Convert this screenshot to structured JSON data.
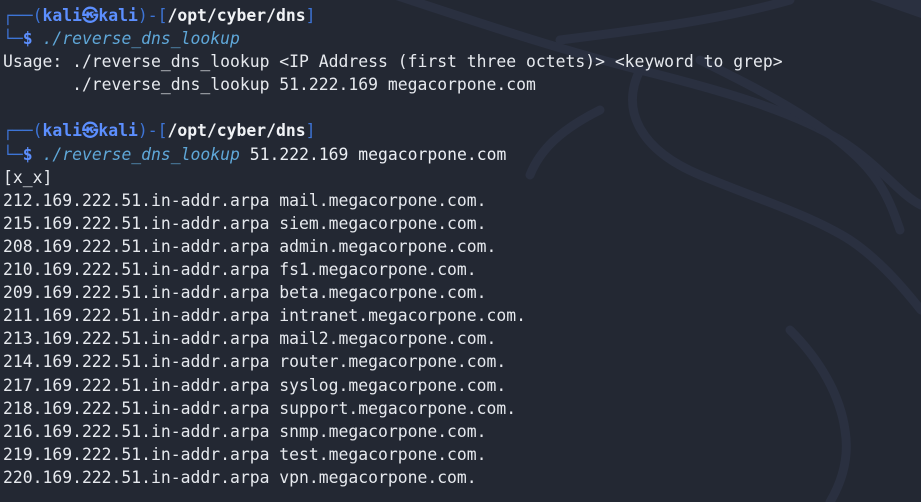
{
  "prompt1": {
    "top_left": "┌──(",
    "user": "kali",
    "skull": "㉿",
    "host": "kali",
    "mid": ")-[",
    "path": "/opt/cyber/dns",
    "end": "]",
    "bottom_left": "└─",
    "dollar": "$ ",
    "command": "./reverse_dns_lookup",
    "args": ""
  },
  "usage": [
    "Usage: ./reverse_dns_lookup <IP Address (first three octets)> <keyword to grep>",
    "       ./reverse_dns_lookup 51.222.169 megacorpone.com"
  ],
  "prompt2": {
    "top_left": "┌──(",
    "user": "kali",
    "skull": "㉿",
    "host": "kali",
    "mid": ")-[",
    "path": "/opt/cyber/dns",
    "end": "]",
    "bottom_left": "└─",
    "dollar": "$ ",
    "command": "./reverse_dns_lookup",
    "args": " 51.222.169 megacorpone.com"
  },
  "output_header": "[x_x]",
  "results": [
    "212.169.222.51.in-addr.arpa mail.megacorpone.com.",
    "215.169.222.51.in-addr.arpa siem.megacorpone.com.",
    "208.169.222.51.in-addr.arpa admin.megacorpone.com.",
    "210.169.222.51.in-addr.arpa fs1.megacorpone.com.",
    "209.169.222.51.in-addr.arpa beta.megacorpone.com.",
    "211.169.222.51.in-addr.arpa intranet.megacorpone.com.",
    "213.169.222.51.in-addr.arpa mail2.megacorpone.com.",
    "214.169.222.51.in-addr.arpa router.megacorpone.com.",
    "217.169.222.51.in-addr.arpa syslog.megacorpone.com.",
    "218.169.222.51.in-addr.arpa support.megacorpone.com.",
    "216.169.222.51.in-addr.arpa snmp.megacorpone.com.",
    "219.169.222.51.in-addr.arpa test.megacorpone.com.",
    "220.169.222.51.in-addr.arpa vpn.megacorpone.com."
  ],
  "colors": {
    "background": "#232833",
    "prompt_blue": "#5c8fff",
    "corner_blue": "#3d74d6",
    "command_cyan": "#5fa7d8",
    "text": "#eceff4"
  },
  "background_logo": "kali-dragon-watermark"
}
